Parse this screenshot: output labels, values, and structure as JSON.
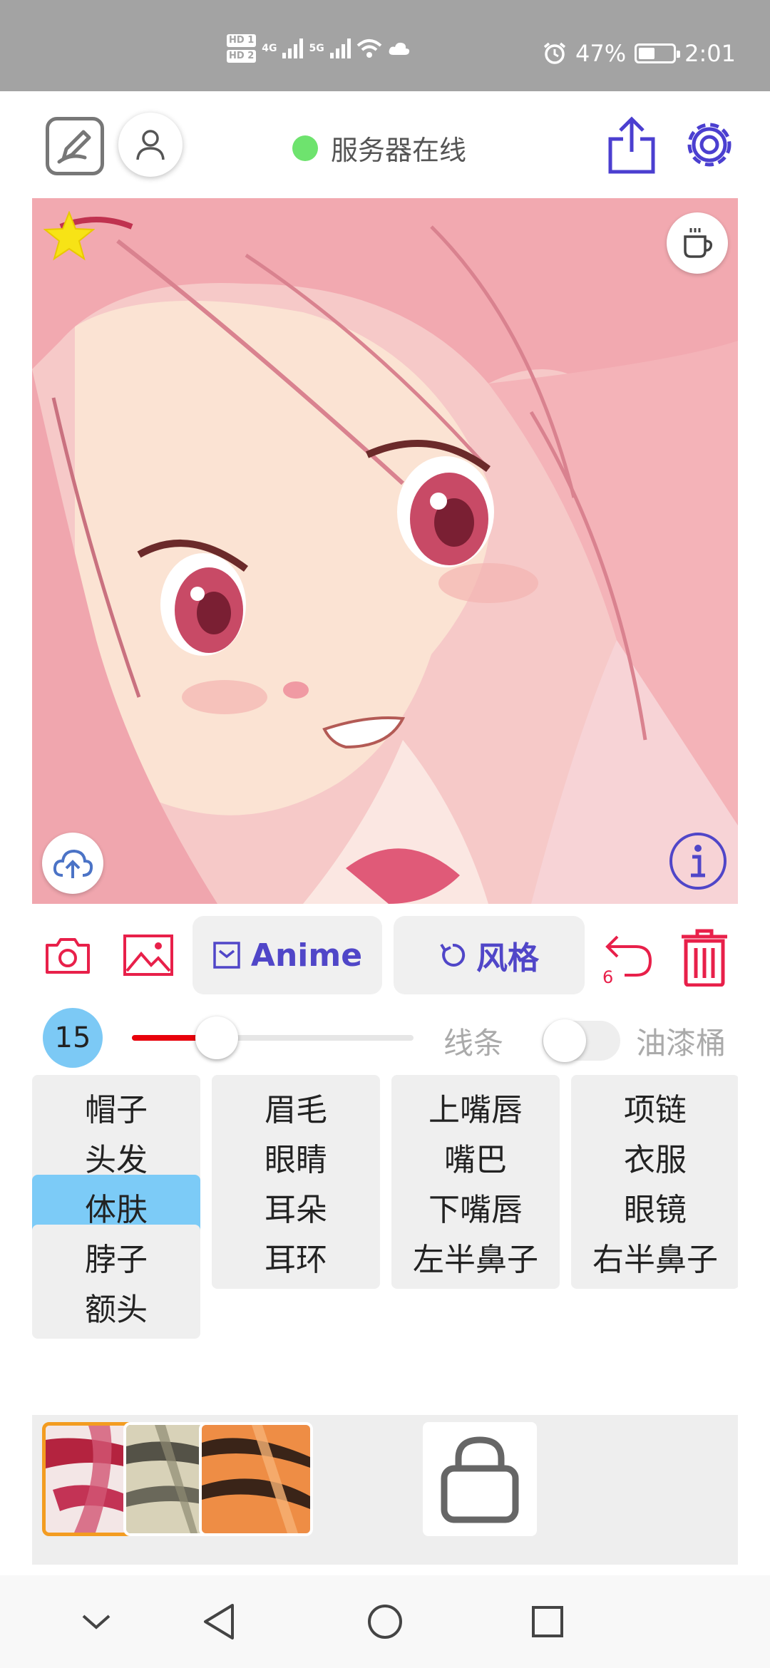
{
  "status_bar": {
    "hd1": "HD 1",
    "hd2": "HD 2",
    "net1": "4G",
    "net2": "5G",
    "battery_percent": "47%",
    "time": "2:01"
  },
  "header": {
    "server_status": "服务器在线",
    "status_color": "#6ee36e",
    "icons": [
      "edit-icon",
      "user-icon",
      "share-icon",
      "gear-icon"
    ]
  },
  "canvas": {
    "icons": [
      "star-icon",
      "coffee-cup-icon",
      "cloud-upload-icon",
      "info-icon"
    ]
  },
  "toolbar": {
    "anime_label": "Anime",
    "style_label": "风格",
    "undo_count": "6",
    "icons": [
      "camera-icon",
      "gallery-icon",
      "checkbox-icon",
      "refresh-icon",
      "undo-icon",
      "trash-icon"
    ],
    "accent_color": "#e8204a",
    "brand_color": "#5046c8"
  },
  "brush": {
    "size": "15",
    "size_fraction": 0.3,
    "line_label": "线条",
    "bucket_label": "油漆桶",
    "bucket_enabled": false
  },
  "tags": {
    "items": [
      "帽子",
      "眉毛",
      "上嘴唇",
      "项链",
      "头发",
      "眼睛",
      "嘴巴",
      "衣服",
      "体肤",
      "耳朵",
      "下嘴唇",
      "眼镜",
      "脖子",
      "耳环",
      "左半鼻子",
      "右半鼻子",
      "额头"
    ],
    "selected": "体肤"
  },
  "palette": {
    "swatches": [
      "crimson-white",
      "olive-beige",
      "orange-black"
    ],
    "selected_index": 0,
    "locked_icon": "lock-icon"
  },
  "navbar": {
    "icons": [
      "collapse-icon",
      "back-icon",
      "home-icon",
      "recents-icon"
    ]
  }
}
